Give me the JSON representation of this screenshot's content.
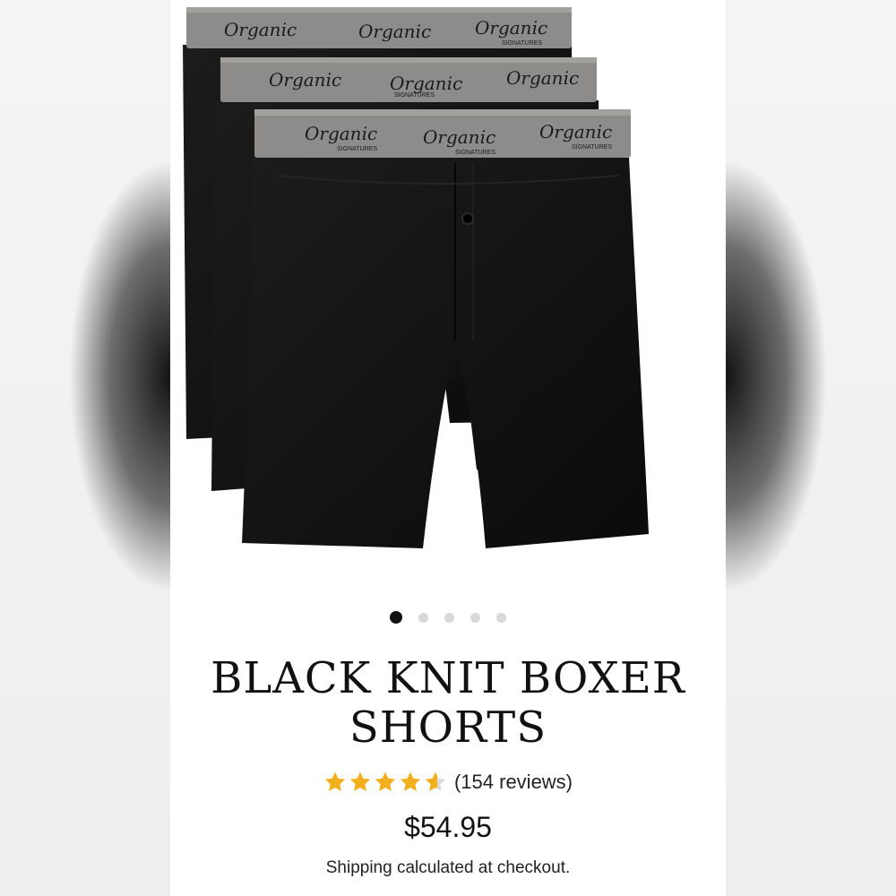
{
  "product": {
    "title_line1": "BLACK KNIT BOXER",
    "title_line2": "SHORTS",
    "rating": 4.6,
    "review_count_text": "(154 reviews)",
    "price": "$54.95",
    "shipping_text": "Shipping calculated at checkout."
  },
  "image": {
    "brand": "Organic",
    "brand_sub": "SIGNATURES",
    "subject": "three-black-knit-boxer-shorts",
    "waistband_color": "#8e8c8a",
    "fabric_color": "#121212"
  },
  "carousel": {
    "total": 5,
    "active": 1
  },
  "colors": {
    "star": "#f2b01e",
    "star_empty": "#dcdcdc",
    "text": "#111111",
    "dot_active": "#111111",
    "dot_inactive": "#d9d9d9"
  }
}
